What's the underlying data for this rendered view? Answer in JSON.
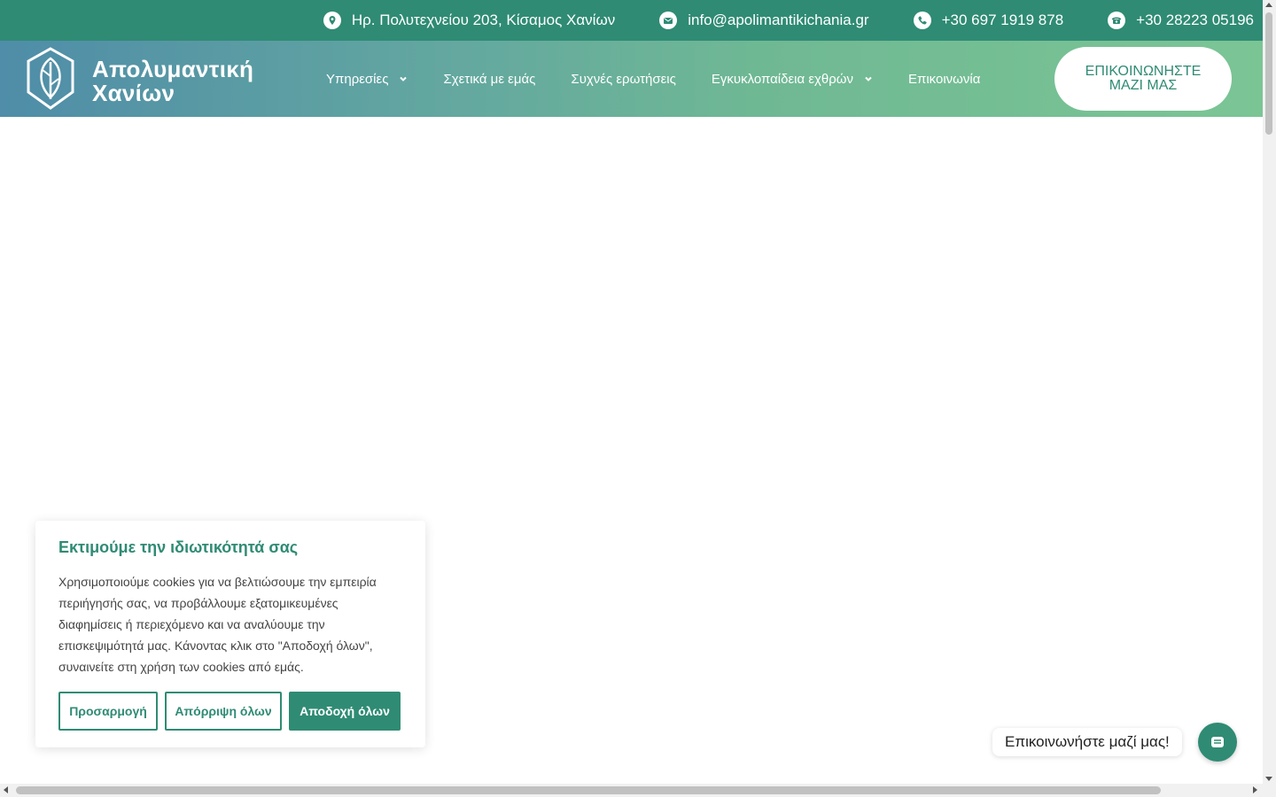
{
  "topbar": {
    "address": "Ηρ. Πολυτεχνείου 203, Κίσαμος Χανίων",
    "email": "info@apolimantikichania.gr",
    "mobile": "+30 697 1919 878",
    "phone": "+30 28223 05196"
  },
  "logo": {
    "line1": "Απολυμαντική",
    "line2": "Χανίων"
  },
  "nav": {
    "services": "Υπηρεσίες",
    "about": "Σχετικά με εμάς",
    "faq": "Συχνές ερωτήσεις",
    "encyclopedia": "Εγκυκλοπαίδεια εχθρών",
    "contact": "Επικοινωνία"
  },
  "cta": {
    "label": "ΕΠΙΚΟΙΝΩΝΗΣΤΕ ΜΑΖΙ ΜΑΣ"
  },
  "cookie": {
    "title": "Εκτιμούμε την ιδιωτικότητά σας",
    "text": "Χρησιμοποιούμε cookies για να βελτιώσουμε την εμπειρία περιήγησής σας, να προβάλλουμε εξατομικευμένες διαφημίσεις ή περιεχόμενο και να αναλύουμε την επισκεψιμότητά μας. Κάνοντας κλικ στο \"Αποδοχή όλων\", συναινείτε στη χρήση των cookies από εμάς.",
    "customize": "Προσαρμογή",
    "reject": "Απόρριψη όλων",
    "accept": "Αποδοχή όλων"
  },
  "chat": {
    "label": "Επικοινωνήστε μαζί μας!"
  },
  "colors": {
    "brand": "#2f8b74",
    "header_start": "#4f8da8",
    "header_end": "#7bc595"
  },
  "icons": [
    "location-icon",
    "email-icon",
    "mobile-phone-icon",
    "landline-phone-icon",
    "logo-leaf-icon",
    "chevron-down-icon",
    "chat-icon"
  ]
}
